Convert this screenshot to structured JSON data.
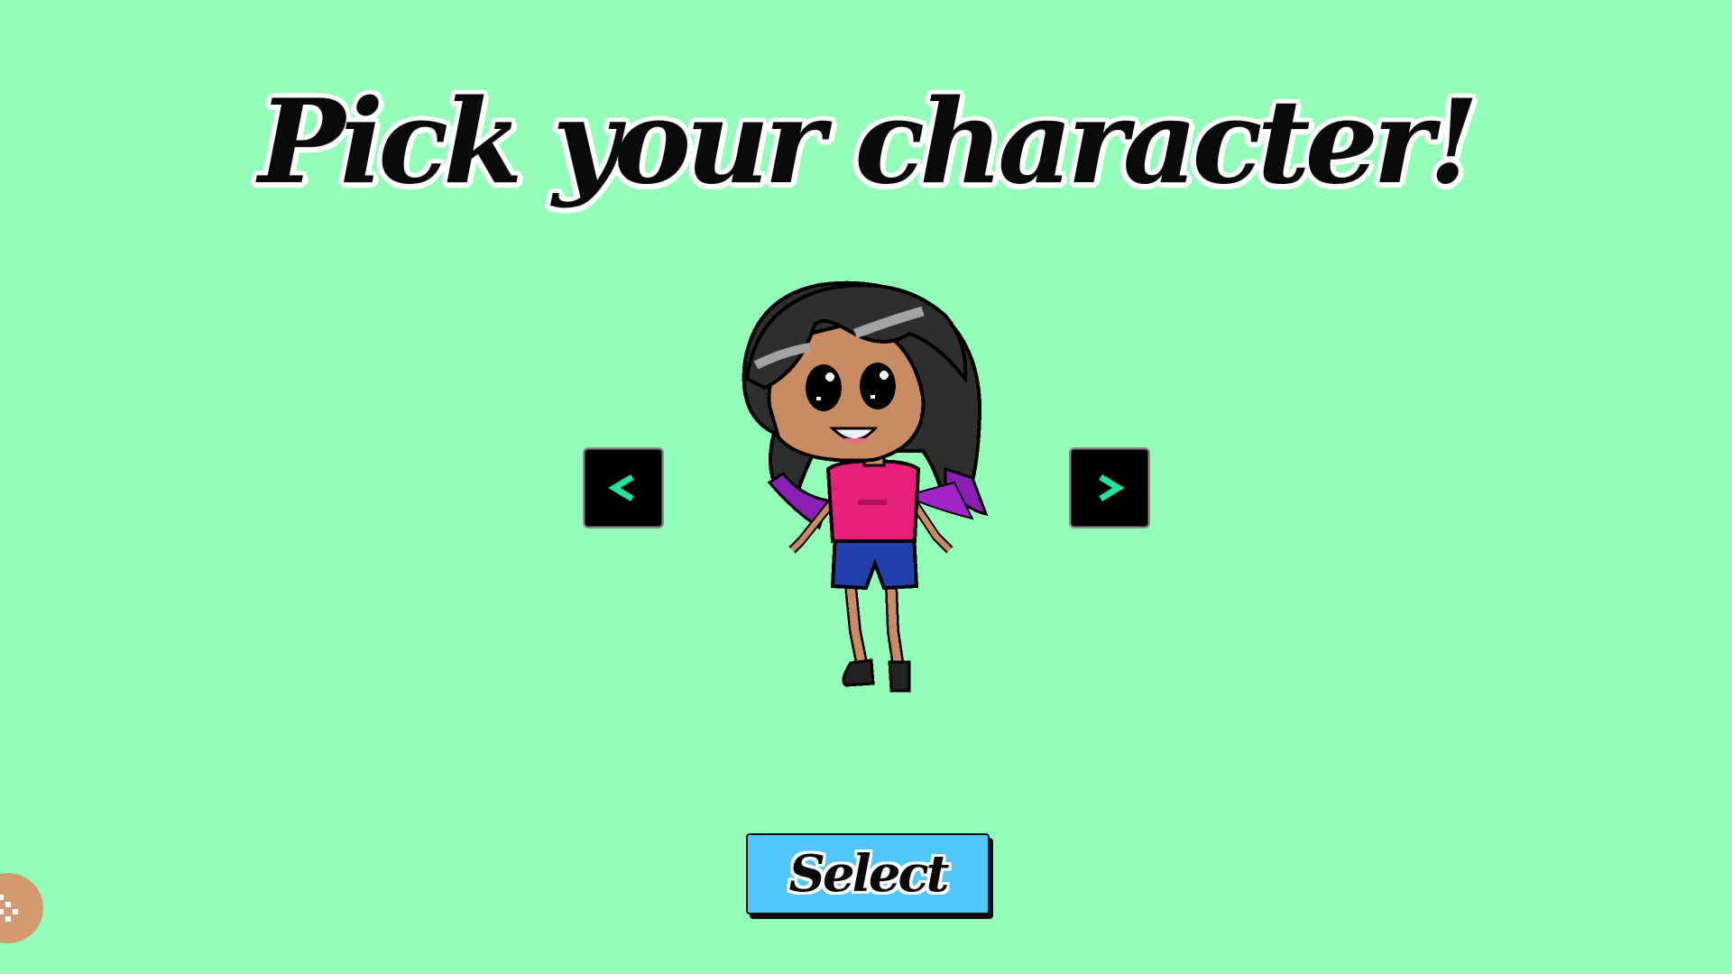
{
  "title": "Pick your character!",
  "navigation": {
    "prev_icon": "chevron-left-icon",
    "next_icon": "chevron-right-icon"
  },
  "character": {
    "skin_color": "#c98b62",
    "hair_color": "#2e2e2e",
    "hair_tips_color": "#8a1fb3",
    "shirt_color": "#e8207a",
    "shorts_color": "#223fae"
  },
  "select_button": {
    "label": "Select"
  },
  "colors": {
    "background": "#94fdb9",
    "nav_button": "#000000",
    "nav_arrow": "#25e39a",
    "select_button": "#52c6f8"
  },
  "corner_widget": {
    "icon": "dice-icon"
  }
}
